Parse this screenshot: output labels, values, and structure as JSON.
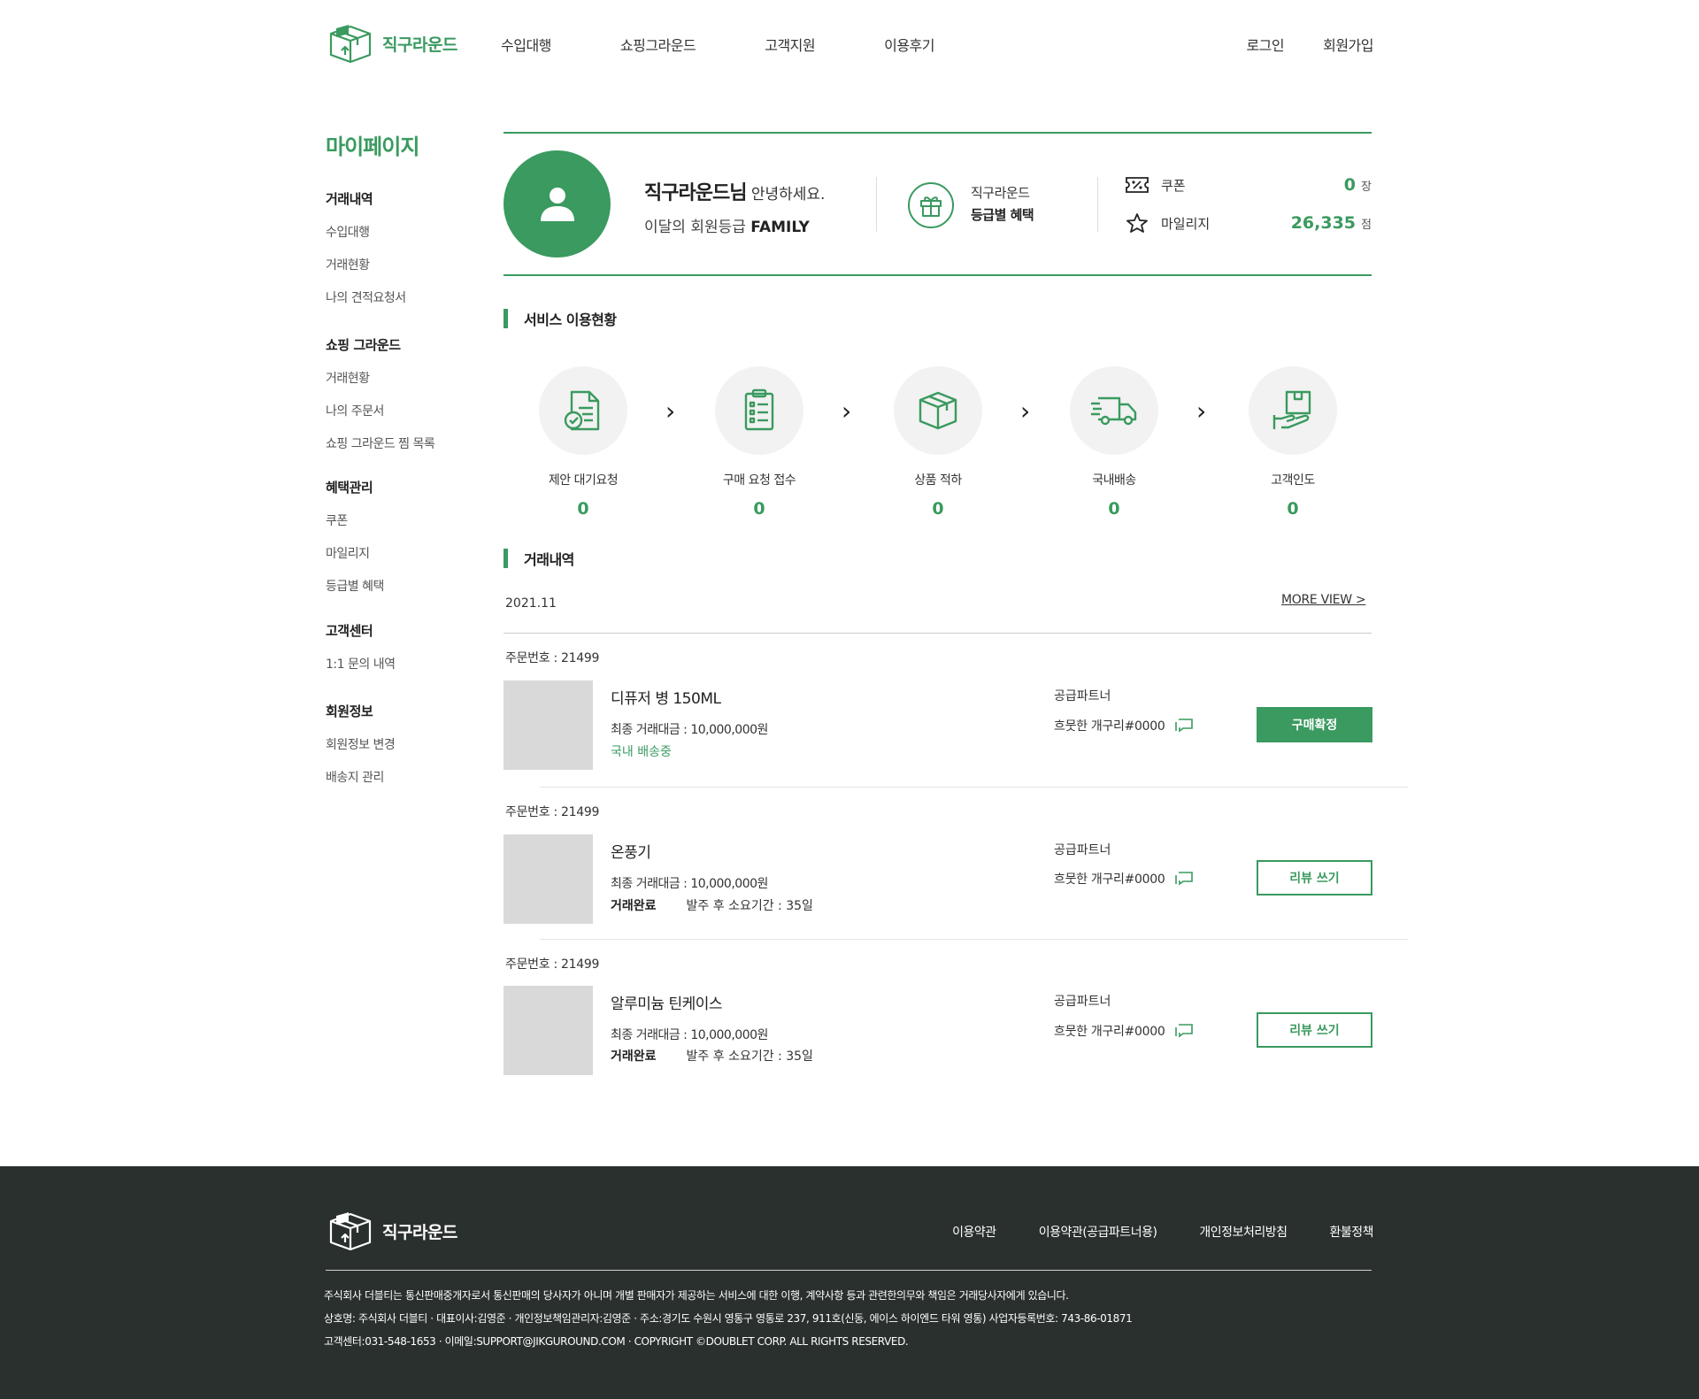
{
  "header": {
    "logo_text": "직구라운드",
    "nav": [
      "수입대행",
      "쇼핑그라운드",
      "고객지원",
      "이용후기"
    ],
    "login": "로그인",
    "signup": "회원가입"
  },
  "sidebar": {
    "title": "마이페이지",
    "groups": [
      {
        "title": "거래내역",
        "items": [
          "수입대행",
          "거래현황",
          "나의 견적요청서"
        ]
      },
      {
        "title": "쇼핑 그라운드",
        "items": [
          "거래현황",
          "나의 주문서",
          "쇼핑 그라운드 찜 목록"
        ]
      },
      {
        "title": "혜택관리",
        "items": [
          "쿠폰",
          "마일리지",
          "등급별 혜택"
        ]
      },
      {
        "title": "고객센터",
        "items": [
          "1:1 문의 내역"
        ]
      },
      {
        "title": "회원정보",
        "items": [
          "회원정보 변경",
          "배송지 관리"
        ]
      }
    ]
  },
  "profile": {
    "name": "직구라운드님",
    "hello": " 안녕하세요.",
    "grade_prefix": "이달의 회원등급 ",
    "grade": "FAMILY",
    "benefit_line1": "직구라운드",
    "benefit_line2": "등급별 혜택",
    "coupon_label": "쿠폰",
    "coupon_value": "0",
    "coupon_unit": "장",
    "mileage_label": "마일리지",
    "mileage_value": "26,335",
    "mileage_unit": "점"
  },
  "service": {
    "title": "서비스 이용현황",
    "steps": [
      {
        "label": "제안 대기요청",
        "count": "0",
        "icon": "document-check-icon"
      },
      {
        "label": "구매 요청 접수",
        "count": "0",
        "icon": "clipboard-list-icon"
      },
      {
        "label": "상품 적하",
        "count": "0",
        "icon": "box-icon"
      },
      {
        "label": "국내배송",
        "count": "0",
        "icon": "truck-icon"
      },
      {
        "label": "고객인도",
        "count": "0",
        "icon": "hand-box-icon"
      }
    ]
  },
  "orders": {
    "title": "거래내역",
    "period": "2021.11",
    "more": "MORE VIEW >",
    "partner_label": "공급파트너",
    "items": [
      {
        "order_no": "주문번호 : 21499",
        "name": "디퓨저 병 150ML",
        "price": "최종 거래대금 : 10,000,000원",
        "shipping": "국내 배송중",
        "partner": "흐뭇한 개구리#0000",
        "button": "구매확정"
      },
      {
        "order_no": "주문번호 : 21499",
        "name": "온풍기",
        "price": "최종 거래대금 : 10,000,000원",
        "status": "거래완료",
        "lead_time": "발주 후 소요기간 : 35일",
        "partner": "흐뭇한 개구리#0000",
        "button": "리뷰 쓰기"
      },
      {
        "order_no": "주문번호 : 21499",
        "name": "알루미늄 틴케이스",
        "price": "최종 거래대금 : 10,000,000원",
        "status": "거래완료",
        "lead_time": "발주 후 소요기간 : 35일",
        "partner": "흐뭇한 개구리#0000",
        "button": "리뷰 쓰기"
      }
    ]
  },
  "footer": {
    "logo_text": "직구라운드",
    "links": [
      "이용약관",
      "이용약관(공급파트너용)",
      "개인정보처리방침",
      "환불정책"
    ],
    "line1": "주식회사 더블티는 통신판매중개자로서 통신판매의 당사자가 아니며 개별 판매자가 제공하는 서비스에 대한 이행, 계약사항 등과 관련한의무와 책임은 거래당사자에게 있습니다.",
    "line2": "상호명: 주식회사 더블티 · 대표이사:김영준 · 개인정보책임관리자:김영준 · 주소:경기도 수원시 영통구 영통로 237, 911호(신동, 에이스 하이엔드 타워 영통) 사업자등록번호: 743-86-01871",
    "line3": "고객센터:031-548-1653 · 이메일:SUPPORT@JIKGUROUND.COM · COPYRIGHT ©DOUBLET CORP. ALL RIGHTS RESERVED."
  },
  "colors": {
    "accent": "#3a9a5f",
    "footer_bg": "#2a302d",
    "thumb": "#d9d9d9"
  }
}
